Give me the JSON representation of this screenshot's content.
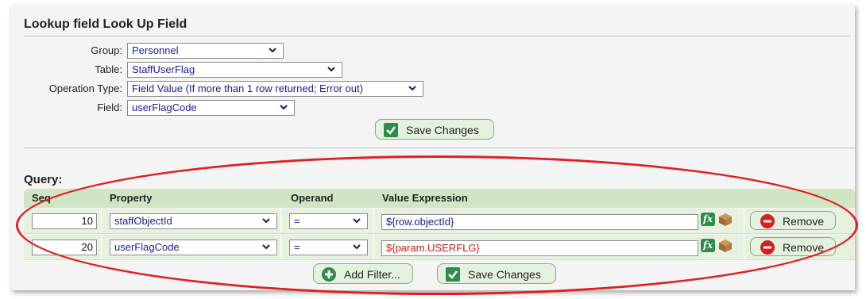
{
  "panel": {
    "title": "Lookup field Look Up Field"
  },
  "form": {
    "group_label": "Group:",
    "group_value": "Personnel",
    "table_label": "Table:",
    "table_value": "StaffUserFlag",
    "operation_label": "Operation Type:",
    "operation_value": "Field Value (If more than 1 row returned; Error out)",
    "field_label": "Field:",
    "field_value": "userFlagCode",
    "save_label": "Save Changes"
  },
  "query": {
    "title": "Query:",
    "columns": {
      "seq": "Seq",
      "property": "Property",
      "operand": "Operand",
      "value": "Value Expression"
    },
    "rows": [
      {
        "seq": "10",
        "property": "staffObjectId",
        "operand": "=",
        "expression": "${row.objectId}",
        "expression_color": "#1a1a9a",
        "remove_label": "Remove"
      },
      {
        "seq": "20",
        "property": "userFlagCode",
        "operand": "=",
        "expression": "${param.USERFLG}",
        "expression_color": "#d01818",
        "remove_label": "Remove"
      }
    ],
    "add_filter_label": "Add Filter...",
    "save_label": "Save Changes"
  },
  "icons": {
    "fx": "fx",
    "chevron": "chevron-down-icon",
    "check": "check-icon",
    "plus": "plus-circle-icon",
    "remove": "minus-circle-icon",
    "box": "box-icon"
  },
  "colors": {
    "accent_green": "#2d8c4a",
    "annotation_red": "#e02020",
    "remove_red": "#d42020"
  }
}
